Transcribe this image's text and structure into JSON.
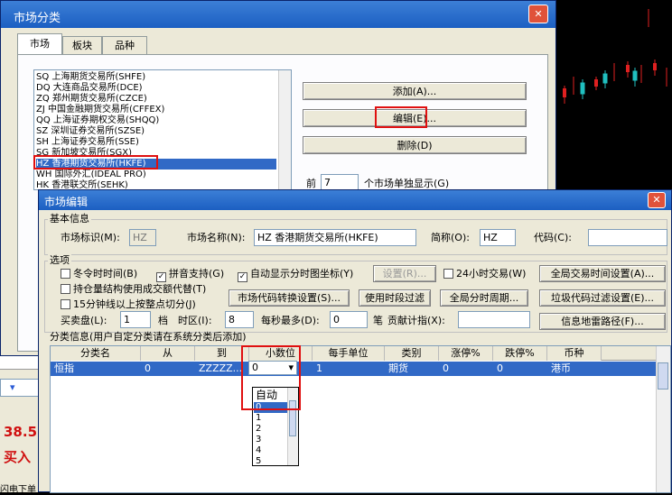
{
  "market_window": {
    "title": "市场分类",
    "tabs": [
      "市场",
      "板块",
      "品种"
    ],
    "list_items": [
      "SQ 上海期货交易所(SHFE)",
      "DQ 大连商品交易所(DCE)",
      "ZQ 郑州期货交易所(CZCE)",
      "ZJ 中国金融期货交易所(CFFEX)",
      "QQ 上海证券期权交易(SHQQ)",
      "SZ 深圳证券交易所(SZSE)",
      "SH 上海证券交易所(SSE)",
      "SG 新加坡交易所(SGX)",
      "HZ 香港期货交易所(HKFE)",
      "WH 国际外汇(IDEAL PRO)",
      "HK 香港联交所(SEHK)"
    ],
    "selected_index": 8,
    "add_button": "添加(A)...",
    "edit_button": "编辑(E)...",
    "delete_button": "删除(D)",
    "front_label": "前",
    "front_value": "7",
    "front_suffix": "个市场单独显示(G)"
  },
  "edit_window": {
    "title": "市场编辑",
    "basic_section": "基本信息",
    "market_id_label": "市场标识(M):",
    "market_id_value": "HZ",
    "market_name_label": "市场名称(N):",
    "market_name_value": "HZ 香港期货交易所(HKFE)",
    "short_name_label": "简称(O):",
    "short_name_value": "HZ",
    "code_label": "代码(C):",
    "code_value": "",
    "options_section": "选项",
    "opt_winter_time": "冬令时时间(B)",
    "opt_pinyin": "拼音支持(G)",
    "opt_auto_coord": "自动显示分时图坐标(Y)",
    "settings_button": "设置(R)...",
    "opt_24h": "24小时交易(W)",
    "global_time_button": "全局交易时间设置(A)...",
    "opt_position_struct": "持仓量结构使用成交额代替(T)",
    "opt_15min": "15分钟线以上按整点切分(J)",
    "code_convert_button": "市场代码转换设置(S)...",
    "period_filter_button": "使用时段过滤",
    "global_period_button": "全局分时周期...",
    "junk_filter_button": "垃圾代码过滤设置(E)...",
    "buy_sell_label": "买卖盘(L):",
    "buy_sell_value": "1",
    "tier_label": "档",
    "timezone_label": "时区(I):",
    "timezone_value": "8",
    "max_per_sec_label": "每秒最多(D):",
    "max_per_sec_value": "0",
    "bi_label": "笔",
    "contrib_label": "贡献计指(X):",
    "contrib_value": "",
    "info_mine_button": "信息地雷路径(F)...",
    "classify_section": "分类信息(用户自定分类请在系统分类后添加)",
    "columns": [
      "分类名",
      "从",
      "到",
      "小数位",
      "每手单位",
      "类别",
      "涨停%",
      "跌停%",
      "币种"
    ],
    "row": [
      "恒指",
      "0",
      "ZZZZZ...",
      "0",
      "1",
      "期货",
      "0",
      "0",
      "港币"
    ],
    "dropdown_value": "0",
    "dropdown_options": [
      "自动",
      "0",
      "1",
      "2",
      "3",
      "4",
      "5"
    ]
  },
  "background": {
    "left_values": [
      "38.5",
      "买入"
    ],
    "bottom_left": "闪电下单"
  }
}
